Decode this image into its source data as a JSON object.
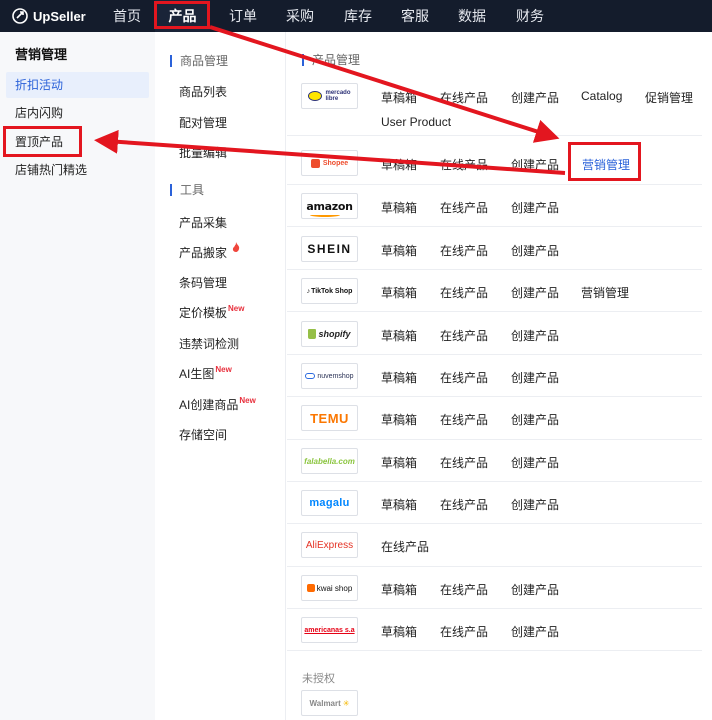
{
  "brand": {
    "name": "UpSeller"
  },
  "topnav": {
    "items": [
      "首页",
      "产品",
      "订单",
      "采购",
      "库存",
      "客服",
      "数据",
      "财务"
    ],
    "active": "产品"
  },
  "left_sidebar": {
    "title": "营销管理",
    "items": [
      "折扣活动",
      "店内闪购",
      "置顶产品",
      "店铺热门精选"
    ],
    "active": "折扣活动"
  },
  "middle_menu": {
    "sections": [
      {
        "title": "商品管理",
        "items": [
          "商品列表",
          "配对管理",
          "批量编辑"
        ]
      },
      {
        "title": "工具",
        "items": [
          "产品采集",
          "产品搬家",
          "条码管理",
          "定价模板",
          "违禁词检测",
          "AI生图",
          "AI创建商品",
          "存储空间"
        ]
      }
    ],
    "badge_new": "New"
  },
  "right_panel": {
    "section_title": "产品管理",
    "unauthorized_label": "未授权",
    "rows": [
      {
        "logo": "mercado libre",
        "links": [
          "草稿箱",
          "在线产品",
          "创建产品",
          "Catalog",
          "促销管理",
          "User Product"
        ]
      },
      {
        "logo": "Shopee",
        "links": [
          "草稿箱",
          "在线产品",
          "创建产品",
          "营销管理"
        ]
      },
      {
        "logo": "amazon",
        "links": [
          "草稿箱",
          "在线产品",
          "创建产品"
        ]
      },
      {
        "logo": "SHEIN",
        "links": [
          "草稿箱",
          "在线产品",
          "创建产品"
        ]
      },
      {
        "logo": "TikTok Shop",
        "links": [
          "草稿箱",
          "在线产品",
          "创建产品",
          "营销管理"
        ]
      },
      {
        "logo": "shopify",
        "links": [
          "草稿箱",
          "在线产品",
          "创建产品"
        ]
      },
      {
        "logo": "nuvemshop",
        "links": [
          "草稿箱",
          "在线产品",
          "创建产品"
        ]
      },
      {
        "logo": "TEMU",
        "links": [
          "草稿箱",
          "在线产品",
          "创建产品"
        ]
      },
      {
        "logo": "falabella.com",
        "links": [
          "草稿箱",
          "在线产品",
          "创建产品"
        ]
      },
      {
        "logo": "magalu",
        "links": [
          "草稿箱",
          "在线产品",
          "创建产品"
        ]
      },
      {
        "logo": "AliExpress",
        "links": [
          "在线产品"
        ]
      },
      {
        "logo": "kwai shop",
        "links": [
          "草稿箱",
          "在线产品",
          "创建产品"
        ]
      },
      {
        "logo": "americanas s.a",
        "links": [
          "草稿箱",
          "在线产品",
          "创建产品"
        ]
      }
    ],
    "unauthorized_rows": [
      {
        "logo": "Walmart"
      }
    ]
  },
  "colors": {
    "nav_bg": "#141c2c",
    "accent_blue": "#2b62d9",
    "annotation_red": "#e3161f"
  }
}
